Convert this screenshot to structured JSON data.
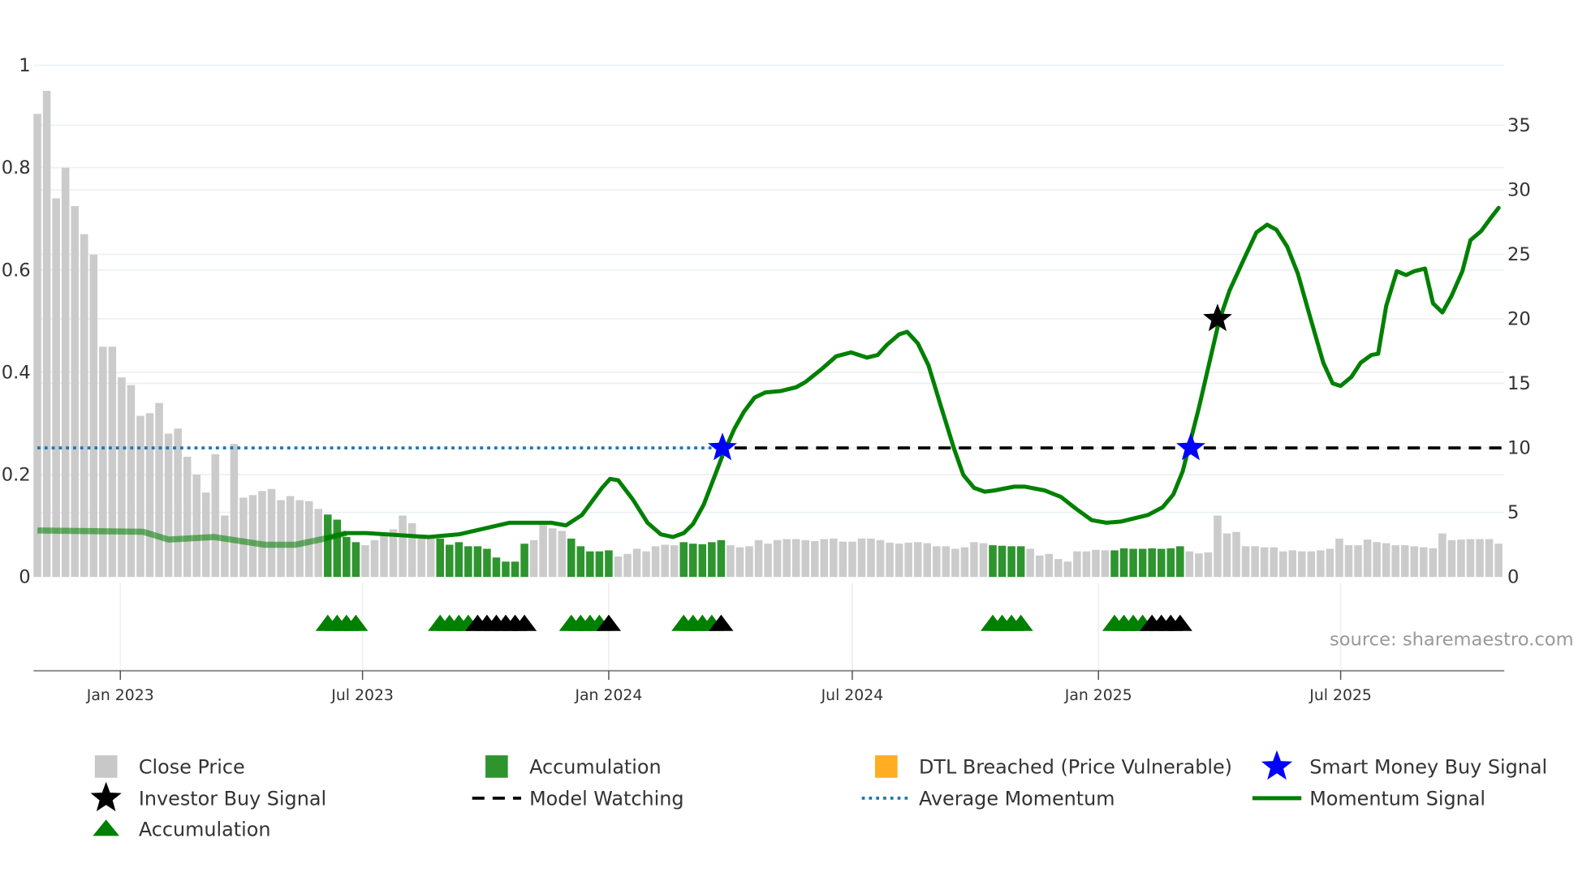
{
  "chart_data": {
    "type": "bar+line",
    "title": "",
    "colors": {
      "close_price": "#c8c8c8",
      "accumulation_bar": "#2e952e",
      "dtl_breached": "#ffad21",
      "smart_money": "#0000ff",
      "investor_buy": "#000000",
      "momentum": "#008000",
      "average_momentum": "#1f77b4",
      "model_watching": "#000000"
    },
    "left_axis": {
      "ylim": [
        0,
        1
      ],
      "ticks": [
        "0",
        "0.2",
        "0.4",
        "0.6",
        "0.8",
        "1"
      ],
      "tick_values": [
        0,
        0.2,
        0.4,
        0.6,
        0.8,
        1
      ]
    },
    "right_axis": {
      "ylim": [
        0,
        35
      ],
      "ticks": [
        "0",
        "5",
        "10",
        "15",
        "20",
        "25",
        "30",
        "35"
      ],
      "tick_values": [
        0,
        5,
        10,
        15,
        20,
        25,
        30,
        35
      ]
    },
    "x_axis": {
      "unit": "days since 2023-01-01",
      "ticks": [
        {
          "label": "Jan 2023",
          "day": 0
        },
        {
          "label": "Jul 2023",
          "day": 181
        },
        {
          "label": "Jan 2024",
          "day": 365
        },
        {
          "label": "Jul 2024",
          "day": 547
        },
        {
          "label": "Jan 2025",
          "day": 731
        },
        {
          "label": "Jul 2025",
          "day": 912
        }
      ],
      "range_days": [
        -66,
        1033
      ]
    },
    "bars": {
      "first_day": -62,
      "step_days": 7,
      "values": [
        0.905,
        0.95,
        0.74,
        0.8,
        0.725,
        0.67,
        0.63,
        0.45,
        0.45,
        0.39,
        0.375,
        0.315,
        0.32,
        0.34,
        0.28,
        0.29,
        0.235,
        0.2,
        0.165,
        0.24,
        0.12,
        0.26,
        0.155,
        0.16,
        0.168,
        0.172,
        0.15,
        0.158,
        0.15,
        0.148,
        0.133,
        0.122,
        0.112,
        0.078,
        0.068,
        0.062,
        0.072,
        0.085,
        0.093,
        0.12,
        0.105,
        0.08,
        0.075,
        0.075,
        0.063,
        0.068,
        0.06,
        0.06,
        0.055,
        0.038,
        0.03,
        0.03,
        0.065,
        0.072,
        0.105,
        0.095,
        0.09,
        0.075,
        0.06,
        0.05,
        0.05,
        0.052,
        0.04,
        0.045,
        0.055,
        0.05,
        0.06,
        0.063,
        0.062,
        0.068,
        0.065,
        0.064,
        0.068,
        0.072,
        0.062,
        0.058,
        0.06,
        0.072,
        0.065,
        0.072,
        0.074,
        0.074,
        0.072,
        0.07,
        0.074,
        0.075,
        0.069,
        0.069,
        0.075,
        0.075,
        0.072,
        0.067,
        0.065,
        0.067,
        0.068,
        0.066,
        0.06,
        0.06,
        0.055,
        0.058,
        0.068,
        0.066,
        0.062,
        0.061,
        0.06,
        0.06,
        0.055,
        0.042,
        0.045,
        0.035,
        0.03,
        0.05,
        0.05,
        0.053,
        0.052,
        0.052,
        0.056,
        0.055,
        0.055,
        0.056,
        0.055,
        0.056,
        0.06,
        0.05,
        0.046,
        0.048,
        0.12,
        0.085,
        0.088,
        0.06,
        0.06,
        0.058,
        0.058,
        0.05,
        0.052,
        0.05,
        0.05,
        0.052,
        0.055,
        0.075,
        0.062,
        0.062,
        0.073,
        0.068,
        0.066,
        0.062,
        0.062,
        0.06,
        0.058,
        0.056,
        0.085,
        0.072,
        0.073,
        0.074,
        0.074,
        0.074,
        0.065
      ],
      "accumulation_indices": [
        31,
        32,
        33,
        34,
        43,
        44,
        45,
        46,
        47,
        48,
        49,
        50,
        51,
        52,
        57,
        58,
        59,
        60,
        61,
        69,
        70,
        71,
        72,
        73,
        102,
        103,
        104,
        105,
        115,
        116,
        117,
        118,
        119,
        120,
        121,
        122
      ]
    },
    "momentum": {
      "faded_before_day": 160,
      "points": [
        [
          -62,
          3.6
        ],
        [
          17,
          3.5
        ],
        [
          36,
          2.9
        ],
        [
          70,
          3.1
        ],
        [
          108,
          2.5
        ],
        [
          131,
          2.5
        ],
        [
          154,
          3.0
        ],
        [
          169,
          3.4
        ],
        [
          184,
          3.4
        ],
        [
          230,
          3.1
        ],
        [
          253,
          3.3
        ],
        [
          291,
          4.2
        ],
        [
          322,
          4.2
        ],
        [
          333,
          4.0
        ],
        [
          345,
          4.8
        ],
        [
          360,
          6.9
        ],
        [
          366,
          7.6
        ],
        [
          372,
          7.5
        ],
        [
          383,
          6.0
        ],
        [
          394,
          4.2
        ],
        [
          404,
          3.3
        ],
        [
          413,
          3.1
        ],
        [
          421,
          3.4
        ],
        [
          428,
          4.1
        ],
        [
          436,
          5.6
        ],
        [
          450,
          9.4
        ],
        [
          459,
          11.5
        ],
        [
          466,
          12.8
        ],
        [
          474,
          13.9
        ],
        [
          482,
          14.3
        ],
        [
          493,
          14.4
        ],
        [
          505,
          14.7
        ],
        [
          512,
          15.1
        ],
        [
          524,
          16.1
        ],
        [
          535,
          17.1
        ],
        [
          546,
          17.4
        ],
        [
          558,
          17.0
        ],
        [
          566,
          17.2
        ],
        [
          573,
          18.0
        ],
        [
          582,
          18.8
        ],
        [
          588,
          19.0
        ],
        [
          596,
          18.1
        ],
        [
          604,
          16.4
        ],
        [
          613,
          13.3
        ],
        [
          623,
          9.95
        ],
        [
          630,
          7.9
        ],
        [
          638,
          6.9
        ],
        [
          646,
          6.6
        ],
        [
          653,
          6.7
        ],
        [
          668,
          7.0
        ],
        [
          676,
          7.0
        ],
        [
          691,
          6.7
        ],
        [
          703,
          6.2
        ],
        [
          714,
          5.3
        ],
        [
          726,
          4.4
        ],
        [
          737,
          4.2
        ],
        [
          748,
          4.3
        ],
        [
          768,
          4.8
        ],
        [
          779,
          5.4
        ],
        [
          787,
          6.4
        ],
        [
          794,
          8.2
        ],
        [
          806,
          13.1
        ],
        [
          821,
          19.8
        ],
        [
          829,
          22.2
        ],
        [
          840,
          24.7
        ],
        [
          849,
          26.7
        ],
        [
          857,
          27.3
        ],
        [
          864,
          26.9
        ],
        [
          872,
          25.6
        ],
        [
          880,
          23.5
        ],
        [
          889,
          20.2
        ],
        [
          899,
          16.6
        ],
        [
          906,
          15.0
        ],
        [
          912,
          14.8
        ],
        [
          920,
          15.5
        ],
        [
          927,
          16.6
        ],
        [
          935,
          17.2
        ],
        [
          940,
          17.3
        ],
        [
          946,
          21.0
        ],
        [
          954,
          23.7
        ],
        [
          961,
          23.4
        ],
        [
          967,
          23.7
        ],
        [
          975,
          23.9
        ],
        [
          981,
          21.2
        ],
        [
          988,
          20.5
        ],
        [
          995,
          21.8
        ],
        [
          1003,
          23.7
        ],
        [
          1009,
          26.1
        ],
        [
          1017,
          26.8
        ],
        [
          1024,
          27.8
        ],
        [
          1030,
          28.6
        ]
      ]
    },
    "average_momentum": {
      "value": 10,
      "from_day": -62,
      "to_day": 450
    },
    "model_watching": {
      "value": 10,
      "from_day": 459,
      "to_day": 1033
    },
    "smart_money_signals": [
      {
        "day": 450,
        "value": 10
      },
      {
        "day": 800,
        "value": 10
      }
    ],
    "investor_buy_signals": [
      {
        "day": 820,
        "value": 20
      }
    ],
    "triangle_markers": {
      "accumulation": [
        31,
        32,
        33,
        34,
        43,
        44,
        45,
        46,
        57,
        58,
        59,
        60,
        69,
        70,
        71,
        72,
        102,
        103,
        104,
        105,
        115,
        116,
        117,
        118
      ],
      "investor_buy": [
        47,
        48,
        49,
        50,
        51,
        52,
        61,
        73,
        119,
        120,
        121,
        122
      ]
    },
    "source": "source: sharemaestro.com",
    "legend": [
      {
        "label": "Close Price",
        "icon": "gray-square"
      },
      {
        "label": "Accumulation",
        "icon": "green-square"
      },
      {
        "label": "DTL Breached (Price Vulnerable)",
        "icon": "orange-square"
      },
      {
        "label": "Smart Money Buy Signal",
        "icon": "blue-star"
      },
      {
        "label": "Investor Buy Signal",
        "icon": "black-star"
      },
      {
        "label": "Model Watching",
        "icon": "black-dashed-line"
      },
      {
        "label": "Average Momentum",
        "icon": "blue-dotted-line"
      },
      {
        "label": "Momentum Signal",
        "icon": "green-line"
      },
      {
        "label": "Accumulation",
        "icon": "green-triangle"
      }
    ]
  }
}
